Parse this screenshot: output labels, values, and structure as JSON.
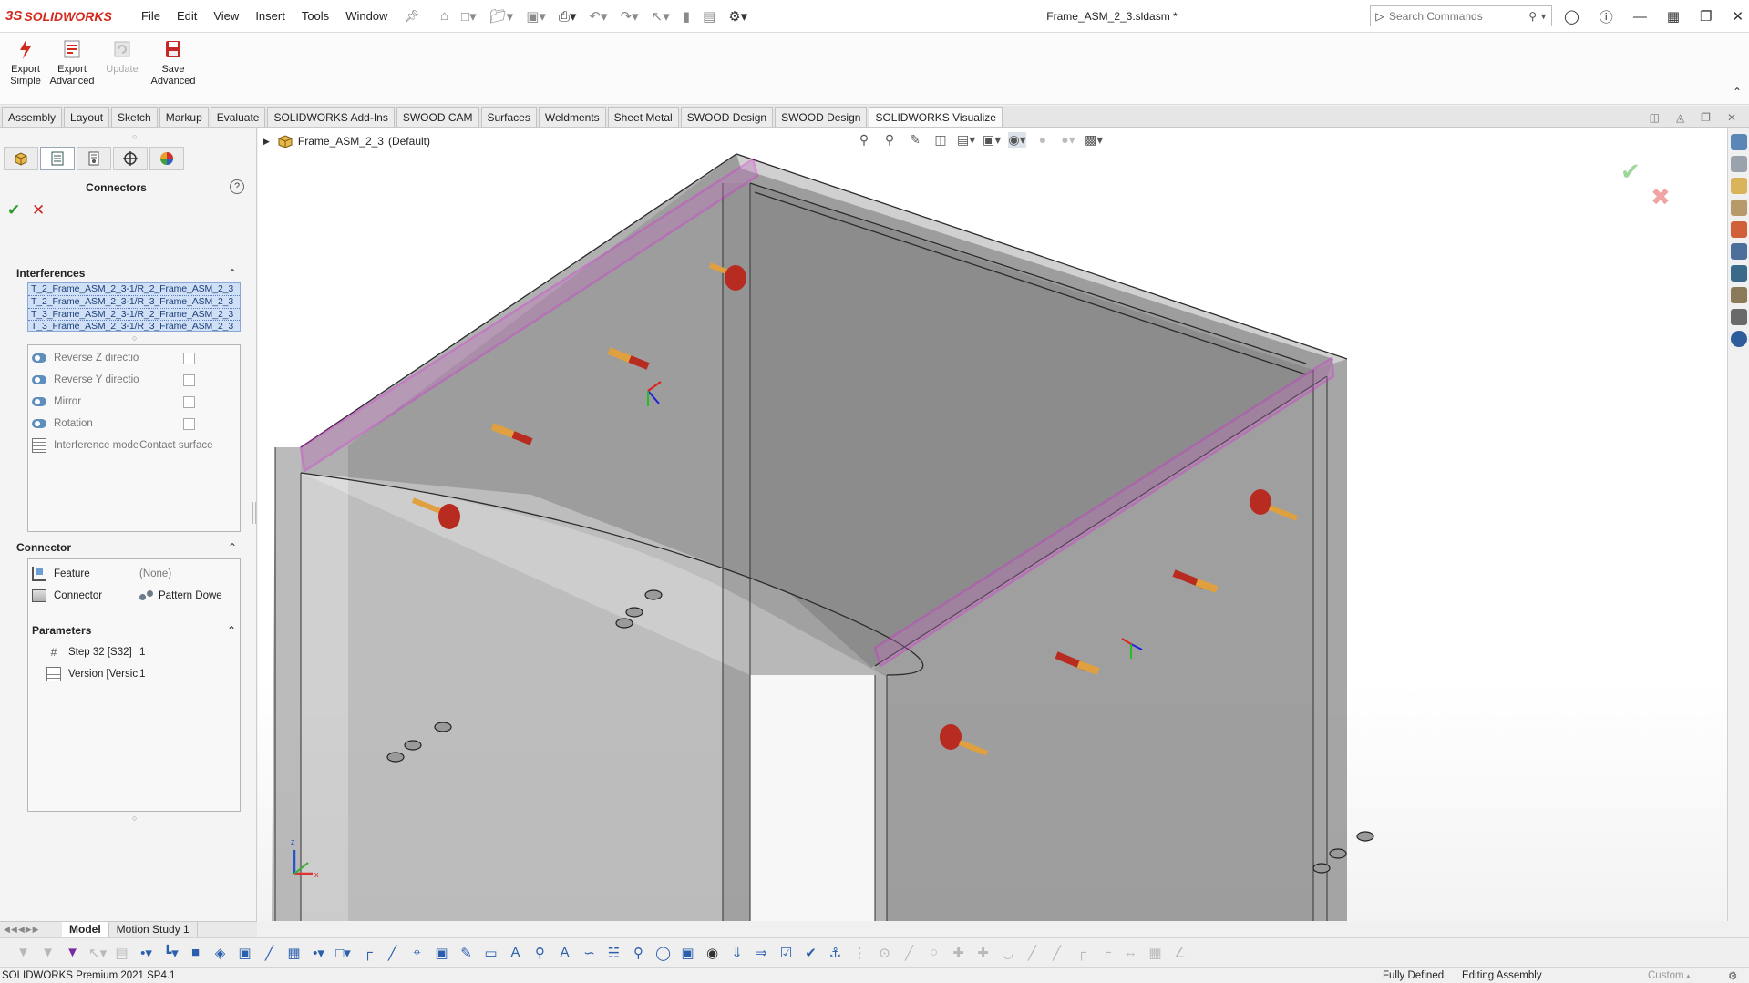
{
  "app": {
    "brand_ds": "3S",
    "brand_name": "SOLIDWORKS",
    "document_title": "Frame_ASM_2_3.sldasm *"
  },
  "menu": [
    "File",
    "Edit",
    "View",
    "Insert",
    "Tools",
    "Window"
  ],
  "search": {
    "placeholder": "Search Commands"
  },
  "command_manager": {
    "buttons": [
      {
        "label_line1": "Export",
        "label_line2": "Simple",
        "enabled": true
      },
      {
        "label_line1": "Export",
        "label_line2": "Advanced",
        "enabled": true
      },
      {
        "label_line1": "Update",
        "label_line2": "",
        "enabled": false
      },
      {
        "label_line1": "Save",
        "label_line2": "Advanced",
        "enabled": true
      }
    ]
  },
  "tabs": [
    "Assembly",
    "Layout",
    "Sketch",
    "Markup",
    "Evaluate",
    "SOLIDWORKS Add-Ins",
    "SWOOD CAM",
    "Surfaces",
    "Weldments",
    "Sheet Metal",
    "SWOOD Design",
    "SWOOD Design",
    "SOLIDWORKS Visualize"
  ],
  "active_tab_index": 12,
  "property_manager": {
    "title": "Connectors",
    "help": "?",
    "ok": "✔",
    "cancel": "✕",
    "interferences": {
      "header": "Interferences",
      "items": [
        "T_2_Frame_ASM_2_3-1/R_2_Frame_ASM_2_3",
        "T_2_Frame_ASM_2_3-1/R_3_Frame_ASM_2_3",
        "T_3_Frame_ASM_2_3-1/R_2_Frame_ASM_2_3",
        "T_3_Frame_ASM_2_3-1/R_3_Frame_ASM_2_3"
      ]
    },
    "options": {
      "reverse_z": "Reverse Z directio",
      "reverse_y": "Reverse Y directio",
      "mirror": "Mirror",
      "rotation": "Rotation",
      "interference_mode_label": "Interference mode",
      "interference_mode_value": "Contact surface"
    },
    "connector": {
      "header": "Connector",
      "feature_label": "Feature",
      "feature_value": "(None)",
      "connector_label": "Connector",
      "connector_value": "Pattern Dowe"
    },
    "parameters": {
      "header": "Parameters",
      "step_label": "Step 32 [S32]",
      "step_value": "1",
      "version_label": "Version [Versic",
      "version_value": "1"
    }
  },
  "viewport": {
    "tree_root": "Frame_ASM_2_3",
    "tree_config": "(Default)",
    "highlight_color": "#e020e0",
    "dowel_color": "#c0392b",
    "dowel_tip_color": "#e0a040"
  },
  "bottom_tabs": [
    "Model",
    "Motion Study 1"
  ],
  "status": {
    "app": "SOLIDWORKS Premium 2021 SP4.1",
    "defined": "Fully Defined",
    "editing": "Editing Assembly",
    "units": "Custom"
  }
}
